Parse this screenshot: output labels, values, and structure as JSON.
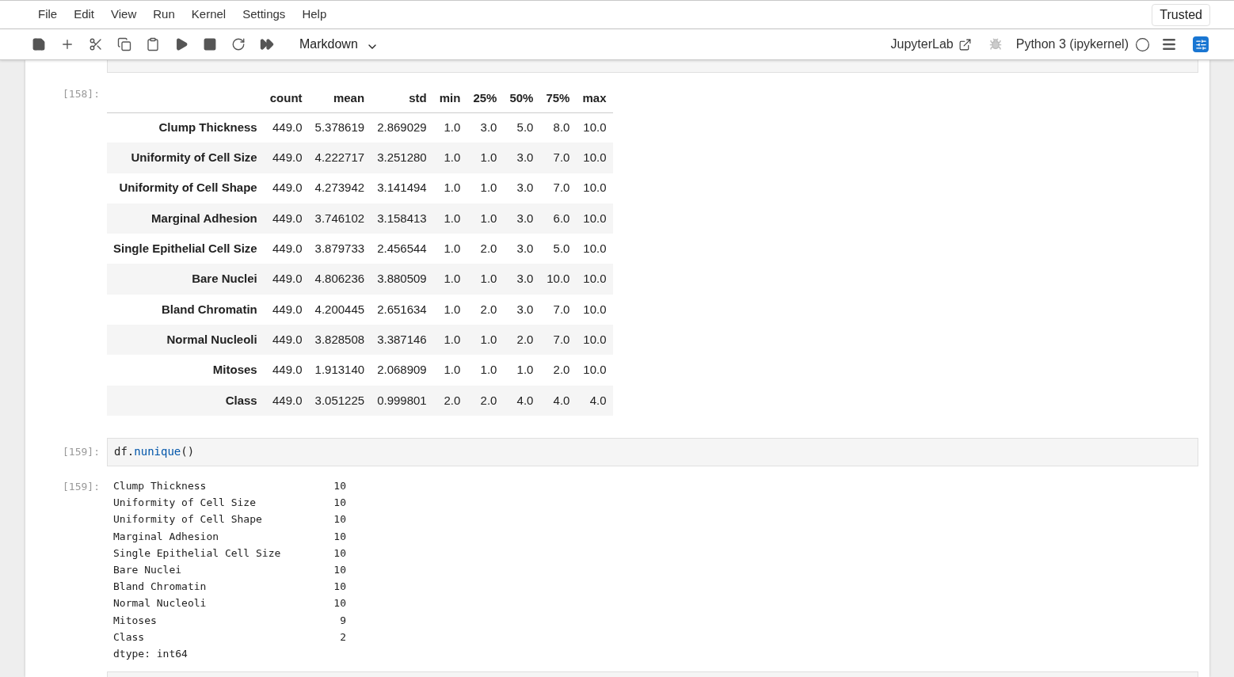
{
  "menu": [
    "File",
    "Edit",
    "View",
    "Run",
    "Kernel",
    "Settings",
    "Help"
  ],
  "trusted": "Trusted",
  "toolbar": {
    "cell_type": "Markdown",
    "open_in": "JupyterLab",
    "kernel": "Python 3 (ipykernel)"
  },
  "describe_cell": {
    "prompt": "[158]:",
    "columns": [
      "count",
      "mean",
      "std",
      "min",
      "25%",
      "50%",
      "75%",
      "max"
    ],
    "rows": [
      {
        "label": "Clump Thickness",
        "values": [
          "449.0",
          "5.378619",
          "2.869029",
          "1.0",
          "3.0",
          "5.0",
          "8.0",
          "10.0"
        ]
      },
      {
        "label": "Uniformity of Cell Size",
        "values": [
          "449.0",
          "4.222717",
          "3.251280",
          "1.0",
          "1.0",
          "3.0",
          "7.0",
          "10.0"
        ]
      },
      {
        "label": "Uniformity of Cell Shape",
        "values": [
          "449.0",
          "4.273942",
          "3.141494",
          "1.0",
          "1.0",
          "3.0",
          "7.0",
          "10.0"
        ]
      },
      {
        "label": "Marginal Adhesion",
        "values": [
          "449.0",
          "3.746102",
          "3.158413",
          "1.0",
          "1.0",
          "3.0",
          "6.0",
          "10.0"
        ]
      },
      {
        "label": "Single Epithelial Cell Size",
        "values": [
          "449.0",
          "3.879733",
          "2.456544",
          "1.0",
          "2.0",
          "3.0",
          "5.0",
          "10.0"
        ]
      },
      {
        "label": "Bare Nuclei",
        "values": [
          "449.0",
          "4.806236",
          "3.880509",
          "1.0",
          "1.0",
          "3.0",
          "10.0",
          "10.0"
        ]
      },
      {
        "label": "Bland Chromatin",
        "values": [
          "449.0",
          "4.200445",
          "2.651634",
          "1.0",
          "2.0",
          "3.0",
          "7.0",
          "10.0"
        ]
      },
      {
        "label": "Normal Nucleoli",
        "values": [
          "449.0",
          "3.828508",
          "3.387146",
          "1.0",
          "1.0",
          "2.0",
          "7.0",
          "10.0"
        ]
      },
      {
        "label": "Mitoses",
        "values": [
          "449.0",
          "1.913140",
          "2.068909",
          "1.0",
          "1.0",
          "1.0",
          "2.0",
          "10.0"
        ]
      },
      {
        "label": "Class",
        "values": [
          "449.0",
          "3.051225",
          "0.999801",
          "2.0",
          "2.0",
          "4.0",
          "4.0",
          "4.0"
        ]
      }
    ]
  },
  "nunique_cell": {
    "input_prompt": "[159]:",
    "code_object": "df",
    "code_dot": ".",
    "code_method": "nunique",
    "code_parens": "()",
    "output_prompt": "[159]:",
    "rows": [
      {
        "name": "Clump Thickness",
        "value": "10"
      },
      {
        "name": "Uniformity of Cell Size",
        "value": "10"
      },
      {
        "name": "Uniformity of Cell Shape",
        "value": "10"
      },
      {
        "name": "Marginal Adhesion",
        "value": "10"
      },
      {
        "name": "Single Epithelial Cell Size",
        "value": "10"
      },
      {
        "name": "Bare Nuclei",
        "value": "10"
      },
      {
        "name": "Bland Chromatin",
        "value": "10"
      },
      {
        "name": "Normal Nucleoli",
        "value": "10"
      },
      {
        "name": "Mitoses",
        "value": "9"
      },
      {
        "name": "Class",
        "value": "2"
      }
    ],
    "dtype": "dtype: int64"
  }
}
